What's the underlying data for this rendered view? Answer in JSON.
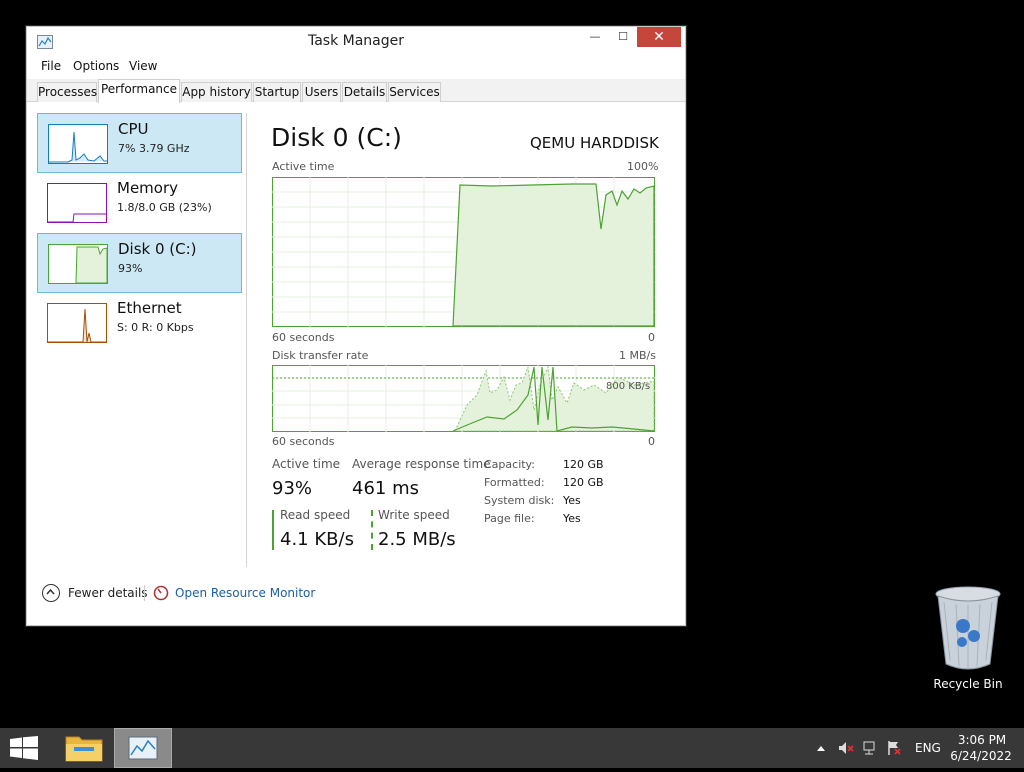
{
  "window": {
    "title": "Task Manager",
    "controls": {
      "minimize": "—",
      "maximize": "☐",
      "close": "✕"
    }
  },
  "menu": [
    "File",
    "Options",
    "View"
  ],
  "tabs": [
    "Processes",
    "Performance",
    "App history",
    "Startup",
    "Users",
    "Details",
    "Services"
  ],
  "sidebar": [
    {
      "title": "CPU",
      "subtitle": "7%  3.79 GHz",
      "color": "#117dbb"
    },
    {
      "title": "Memory",
      "subtitle": "1.8/8.0 GB (23%)",
      "color": "#8b12ae"
    },
    {
      "title": "Disk 0 (C:)",
      "subtitle": "93%",
      "color": "#4da332"
    },
    {
      "title": "Ethernet",
      "subtitle": "S: 0  R: 0 Kbps",
      "color": "#a74f01"
    }
  ],
  "main": {
    "title": "Disk 0 (C:)",
    "model": "QEMU HARDDISK",
    "active_graph": {
      "label": "Active time",
      "max": "100%",
      "left": "60 seconds",
      "right": "0"
    },
    "transfer_graph": {
      "label": "Disk transfer rate",
      "max": "1 MB/s",
      "mid": "800 KB/s",
      "left": "60 seconds",
      "right": "0"
    },
    "stats": {
      "active_time_label": "Active time",
      "active_time_value": "93%",
      "avg_response_label": "Average response time",
      "avg_response_value": "461 ms",
      "read_speed_label": "Read speed",
      "read_speed_value": "4.1 KB/s",
      "write_speed_label": "Write speed",
      "write_speed_value": "2.5 MB/s"
    },
    "properties": [
      {
        "key": "Capacity:",
        "value": "120 GB"
      },
      {
        "key": "Formatted:",
        "value": "120 GB"
      },
      {
        "key": "System disk:",
        "value": "Yes"
      },
      {
        "key": "Page file:",
        "value": "Yes"
      }
    ]
  },
  "footer": {
    "fewer_details": "Fewer details",
    "resource_monitor": "Open Resource Monitor"
  },
  "desktop": {
    "recycle_bin": "Recycle Bin"
  },
  "taskbar": {
    "language": "ENG",
    "time": "3:06 PM",
    "date": "6/24/2022"
  },
  "colors": {
    "accent": "#4da332",
    "close": "#c7463c",
    "selected": "#cce8f4",
    "link": "#1a5fa8"
  }
}
